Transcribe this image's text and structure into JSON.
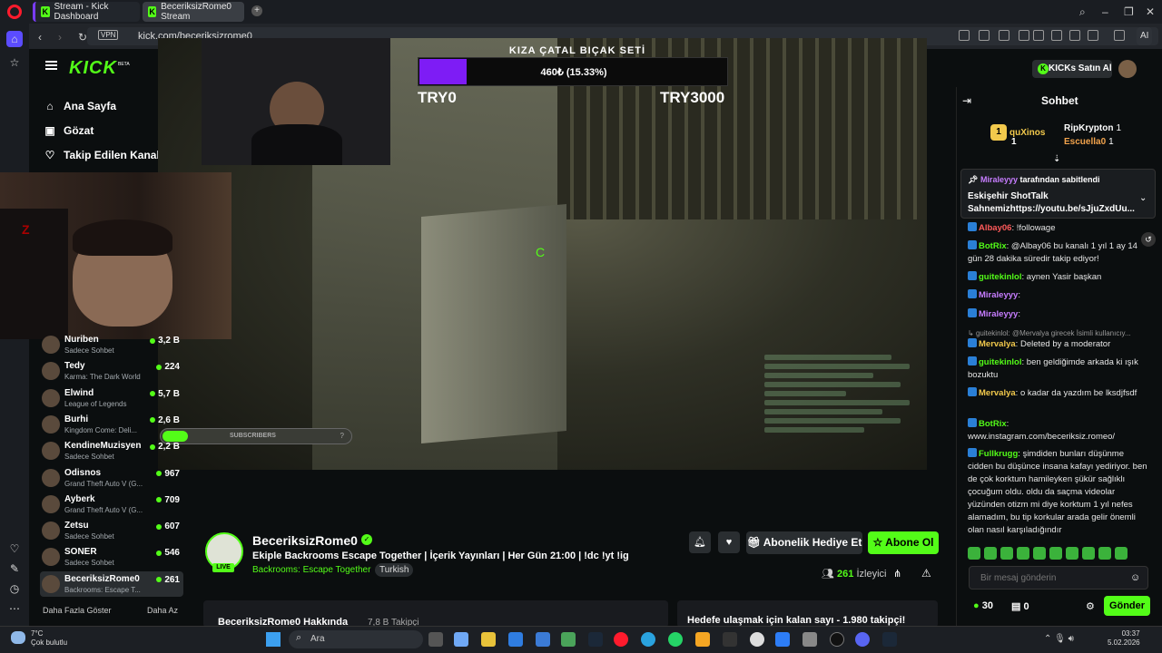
{
  "browser": {
    "tabs": [
      {
        "label": "Stream - Kick Dashboard"
      },
      {
        "label": "BeceriksizRome0 Stream"
      }
    ],
    "url": "kick.com/beceriksizrome0",
    "vpn": "VPN",
    "ai_label": "AI"
  },
  "nav": {
    "home": "Ana Sayfa",
    "browse": "Gözat",
    "following": "Takip Edilen Kanallar",
    "show_more": "Daha Fazla Göster",
    "show_less": "Daha Az"
  },
  "channels": [
    {
      "name": "Nuriben",
      "game": "Sadece Sohbet",
      "viewers": "3,2 B"
    },
    {
      "name": "Tedy",
      "game": "Karma: The Dark World",
      "viewers": "224"
    },
    {
      "name": "Elwind",
      "game": "League of Legends",
      "viewers": "5,7 B"
    },
    {
      "name": "Burhi",
      "game": "Kingdom Come: Deli...",
      "viewers": "2,6 B"
    },
    {
      "name": "KendineMuzisyen",
      "game": "Sadece Sohbet",
      "viewers": "2,2 B"
    },
    {
      "name": "Odisnos",
      "game": "Grand Theft Auto V (G...",
      "viewers": "967"
    },
    {
      "name": "Ayberk",
      "game": "Grand Theft Auto V (G...",
      "viewers": "709"
    },
    {
      "name": "Zetsu",
      "game": "Sadece Sohbet",
      "viewers": "607"
    },
    {
      "name": "SONER",
      "game": "Sadece Sohbet",
      "viewers": "546"
    },
    {
      "name": "BeceriksizRome0",
      "game": "Backrooms: Escape T...",
      "viewers": "261"
    }
  ],
  "header": {
    "logo": "KICK",
    "beta": "BETA",
    "kicks_button": "KICKs Satın Al"
  },
  "goal": {
    "title": "KIZA ÇATAL BIÇAK SETİ",
    "amount": "460₺ (15.33%)",
    "progress": 0.1533,
    "min": "TRY0",
    "max": "TRY3000"
  },
  "overlay": {
    "subscribers_label": "SUBSCRIBERS",
    "subscribers_count": "?"
  },
  "stream": {
    "name": "BeceriksizRome0",
    "live": "LIVE",
    "title": "Ekiple Backrooms Escape Together | İçerik Yayınları | Her Gün 21:00 | !dc !yt !ig",
    "category": "Backrooms: Escape Together",
    "language": "Turkish",
    "gift_button": "Abonelik Hediye Et",
    "subscribe_button": "Abone Ol",
    "viewers": "261",
    "viewers_label": "İzleyici",
    "about": "BeceriksizRome0 Hakkında",
    "followers": "7,8 B Takipçi",
    "goal_info": "Hedefe ulaşmak için kalan sayı - 1.980 takipçi!"
  },
  "chat": {
    "title": "Sohbet",
    "leaders": [
      {
        "rank": "1",
        "name": "quXinos",
        "count": "1"
      },
      {
        "name": "RipKrypton",
        "count": "1"
      },
      {
        "name": "Escuella0",
        "count": "1"
      }
    ],
    "pinned": {
      "by": "Miraleyyy",
      "suffix": "tarafından sabitlendi",
      "text": "Eskişehir ShotTalk Sahnemizhttps://youtu.be/sJjuZxdUu..."
    },
    "messages": [
      {
        "user": "Albay06",
        "text": "!followage",
        "color": "#ff5a5a"
      },
      {
        "user": "BotRix",
        "text": "@Albay06 bu kanalı 1 yıl 1 ay 14 gün 28 dakika süredir takip ediyor!",
        "color": "#53fc18"
      },
      {
        "user": "guitekinlol",
        "text": "aynen Yasir başkan",
        "color": "#53fc18"
      },
      {
        "user": "Miraleyyy",
        "text": "",
        "color": "#c77dff"
      },
      {
        "user": "Miraleyyy",
        "text": "",
        "color": "#c77dff"
      },
      {
        "user": "",
        "text": "guitekinlol: @Mervalya girecek İsimli kullanıcıy...",
        "color": "#999"
      },
      {
        "user": "Mervalya",
        "text": "Deleted by a moderator",
        "color": "#f2c94c"
      },
      {
        "user": "guitekinlol",
        "text": "ben geldiğimde arkada ki ışık bozuktu",
        "color": "#53fc18"
      },
      {
        "user": "Mervalya",
        "text": "o kadar da yazdım be lksdjfsdf",
        "color": "#f2c94c"
      },
      {
        "user": "BotRix",
        "text": "www.instagram.com/beceriksiz.romeo/",
        "color": "#53fc18"
      },
      {
        "user": "Fullkrugg",
        "text": "şimdiden bunları düşünme cidden bu düşünce insana kafayı yediriyor. ben de çok korktum hamileyken şükür sağlıklı çocuğum oldu. oldu da saçma videolar yüzünden otizm mi diye korktum 1 yıl nefes alamadım, bu tip korkular arada gelir önemli olan nasıl karşıladığındır",
        "color": "#53fc18"
      }
    ],
    "input_placeholder": "Bir mesaj gönderin",
    "kicks": "30",
    "chests": "0",
    "send": "Gönder"
  },
  "taskbar": {
    "temp": "7°C",
    "weather": "Çok bulutlu",
    "search": "Ara",
    "time": "03:37",
    "date": "5.02.2026"
  }
}
